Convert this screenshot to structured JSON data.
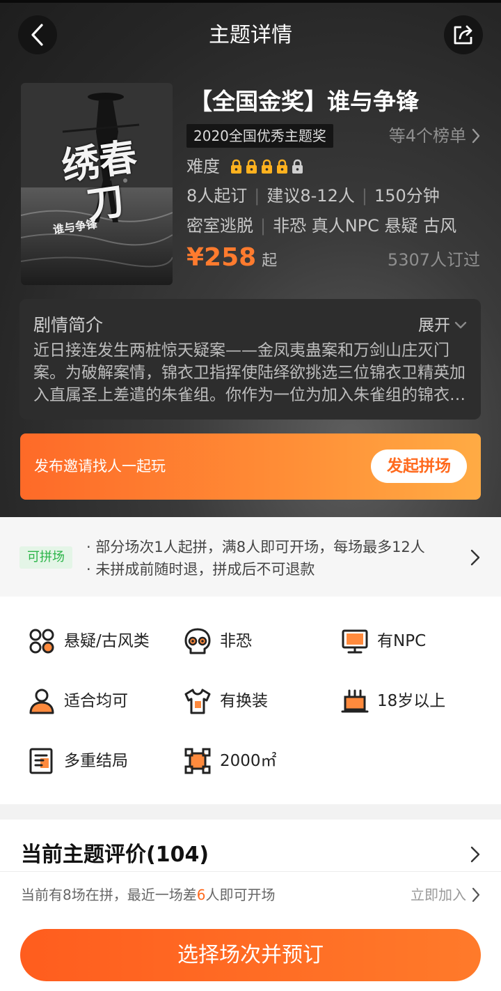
{
  "header": {
    "title": "主题详情"
  },
  "poster": {
    "title_main": "绣春刀",
    "title_sub": "谁与争锋"
  },
  "theme": {
    "title": "【全国金奖】谁与争锋",
    "award": "2020全国优秀主题奖",
    "rank_link": "等4个榜单",
    "difficulty_label": "难度",
    "difficulty_level": 4,
    "difficulty_max": 5,
    "stats": [
      "8人起订",
      "建议8-12人",
      "150分钟"
    ],
    "tags": [
      "密室逃脱",
      "非恐 真人NPC 悬疑 古风"
    ],
    "price": "¥258",
    "price_suffix": "起",
    "booked": "5307人订过"
  },
  "synopsis": {
    "title": "剧情简介",
    "expand": "展开",
    "text": "近日接连发生两桩惊天疑案——金凤夷蛊案和万剑山庄灭门案。为破解案情，锦衣卫指挥使陆绎欲挑选三位锦衣卫精英加入直属圣上差遣的朱雀组。你作为一位为加入朱雀组的锦衣卫精英"
  },
  "invite": {
    "text": "发布邀请找人一起玩",
    "button": "发起拼场"
  },
  "pin": {
    "tag": "可拼场",
    "lines": [
      "· 部分场次1人起拼，满8人即可开场，每场最多12人",
      "· 未拼成前随时退，拼成后不可退款"
    ]
  },
  "features": [
    {
      "icon": "category-icon",
      "label": "悬疑/古风类"
    },
    {
      "icon": "skull-icon",
      "label": "非恐"
    },
    {
      "icon": "monitor-icon",
      "label": "有NPC"
    },
    {
      "icon": "user-icon",
      "label": "适合均可"
    },
    {
      "icon": "shirt-icon",
      "label": "有换装"
    },
    {
      "icon": "cake-icon",
      "label": "18岁以上"
    },
    {
      "icon": "document-icon",
      "label": "多重结局"
    },
    {
      "icon": "area-icon",
      "label": "2000㎡"
    }
  ],
  "review": {
    "title": "当前主题评价(104)"
  },
  "pin_status": {
    "pre": "当前有8场在拼，最近一场差",
    "count": "6",
    "post": "人即可开场",
    "join": "立即加入"
  },
  "book_button": "选择场次并预订",
  "colors": {
    "accent": "#ff6a1e",
    "green": "#2db54a",
    "hero_bg": "#2b2b2b"
  }
}
